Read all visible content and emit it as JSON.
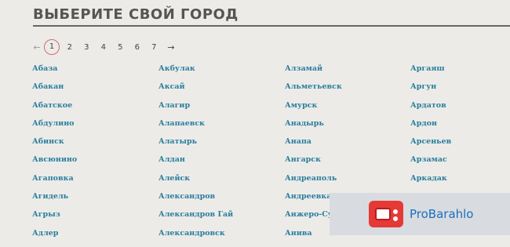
{
  "header": {
    "title": "ВЫБЕРИТЕ СВОЙ ГОРОД"
  },
  "pagination": {
    "prev_icon": "←",
    "next_icon": "→",
    "pages": [
      "1",
      "2",
      "3",
      "4",
      "5",
      "6",
      "7"
    ],
    "current": "1"
  },
  "cities": {
    "col1": [
      "Абаза",
      "Абакан",
      "Абатское",
      "Абдулино",
      "Абинск",
      "Авсюнино",
      "Агаповка",
      "Агидель",
      "Агрыз",
      "Адлер"
    ],
    "col2": [
      "Акбулак",
      "Аксай",
      "Алагир",
      "Алапаевск",
      "Алатырь",
      "Алдан",
      "Алейск",
      "Александров",
      "Александров Гай",
      "Александровск"
    ],
    "col3": [
      "Алзамай",
      "Альметьевск",
      "Амурск",
      "Анадырь",
      "Анапа",
      "Ангарск",
      "Андреаполь",
      "Андреевка",
      "Анжеро-Судженск",
      "Анива"
    ],
    "col4": [
      "Аргаяш",
      "Аргун",
      "Ардатов",
      "Ардон",
      "Арсеньев",
      "Арзамас",
      "Аркадак",
      "",
      "",
      ""
    ]
  },
  "ad": {
    "brand": "ProBarahlo",
    "icon": "radio-icon"
  },
  "colors": {
    "link": "#2a7ea0",
    "title": "#555555",
    "current_page_ring": "#d46d6d",
    "ad_text": "#1e6fbf"
  }
}
